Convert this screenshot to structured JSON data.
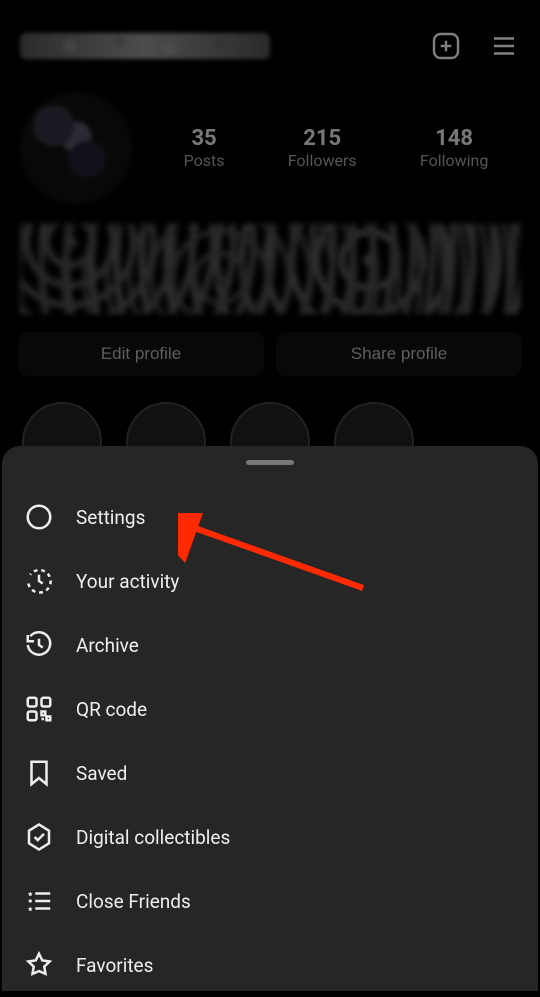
{
  "header": {
    "username_obscured": true
  },
  "stats": {
    "posts": {
      "count": "35",
      "label": "Posts"
    },
    "followers": {
      "count": "215",
      "label": "Followers"
    },
    "following": {
      "count": "148",
      "label": "Following"
    }
  },
  "actions": {
    "edit_label": "Edit profile",
    "share_label": "Share profile"
  },
  "sheet": {
    "items": [
      {
        "icon": "gear-icon",
        "label": "Settings"
      },
      {
        "icon": "activity-icon",
        "label": "Your activity"
      },
      {
        "icon": "archive-icon",
        "label": "Archive"
      },
      {
        "icon": "qr-icon",
        "label": "QR code"
      },
      {
        "icon": "bookmark-icon",
        "label": "Saved"
      },
      {
        "icon": "hexcheck-icon",
        "label": "Digital collectibles"
      },
      {
        "icon": "closefriends-icon",
        "label": "Close Friends"
      },
      {
        "icon": "star-icon",
        "label": "Favorites"
      }
    ]
  },
  "annotation": {
    "type": "arrow",
    "target": "settings-menu-item",
    "color": "#ff2a00"
  }
}
